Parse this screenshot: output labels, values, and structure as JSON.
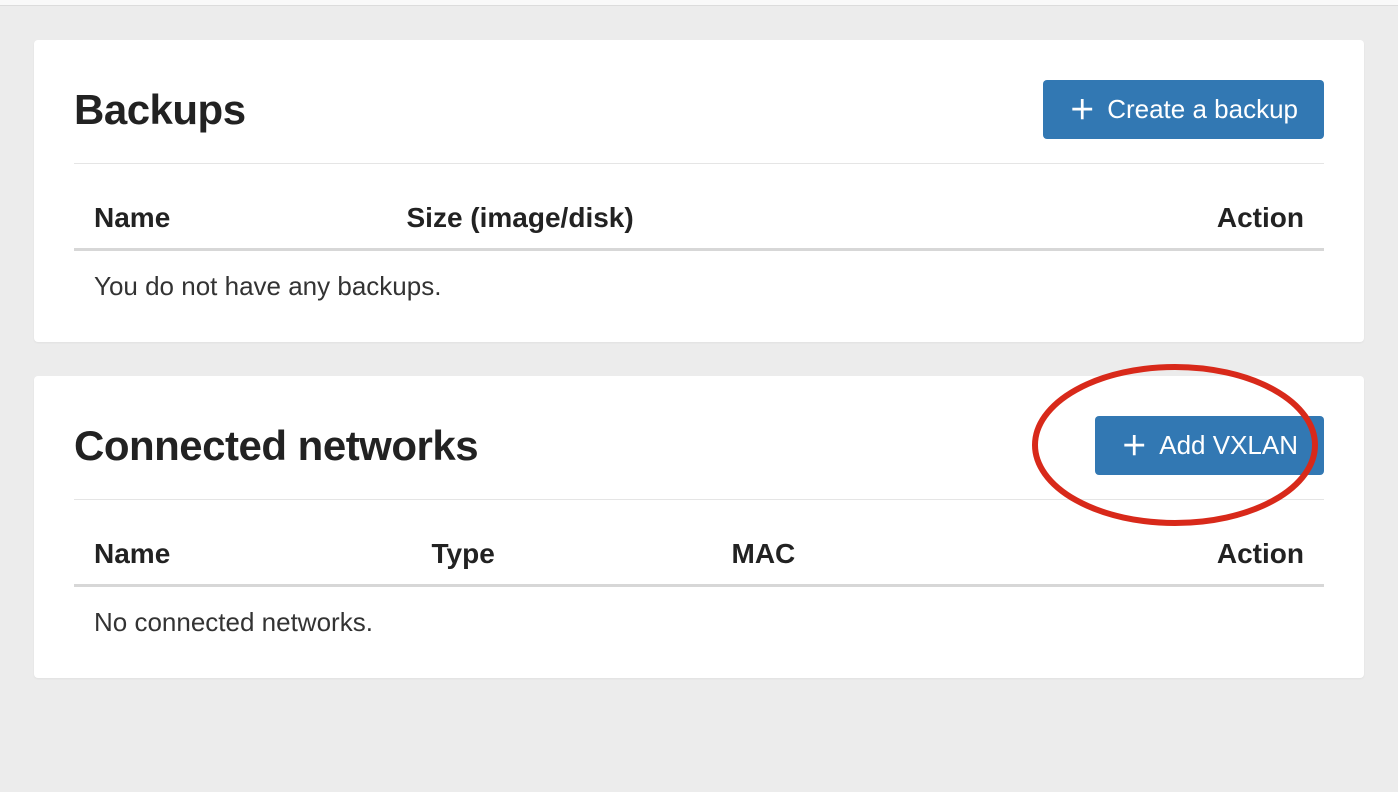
{
  "backups_panel": {
    "title": "Backups",
    "create_button": "Create a backup",
    "columns": {
      "name": "Name",
      "size": "Size (image/disk)",
      "action": "Action"
    },
    "empty_message": "You do not have any backups."
  },
  "networks_panel": {
    "title": "Connected networks",
    "add_button": "Add VXLAN",
    "columns": {
      "name": "Name",
      "type": "Type",
      "mac": "MAC",
      "action": "Action"
    },
    "empty_message": "No connected networks."
  }
}
